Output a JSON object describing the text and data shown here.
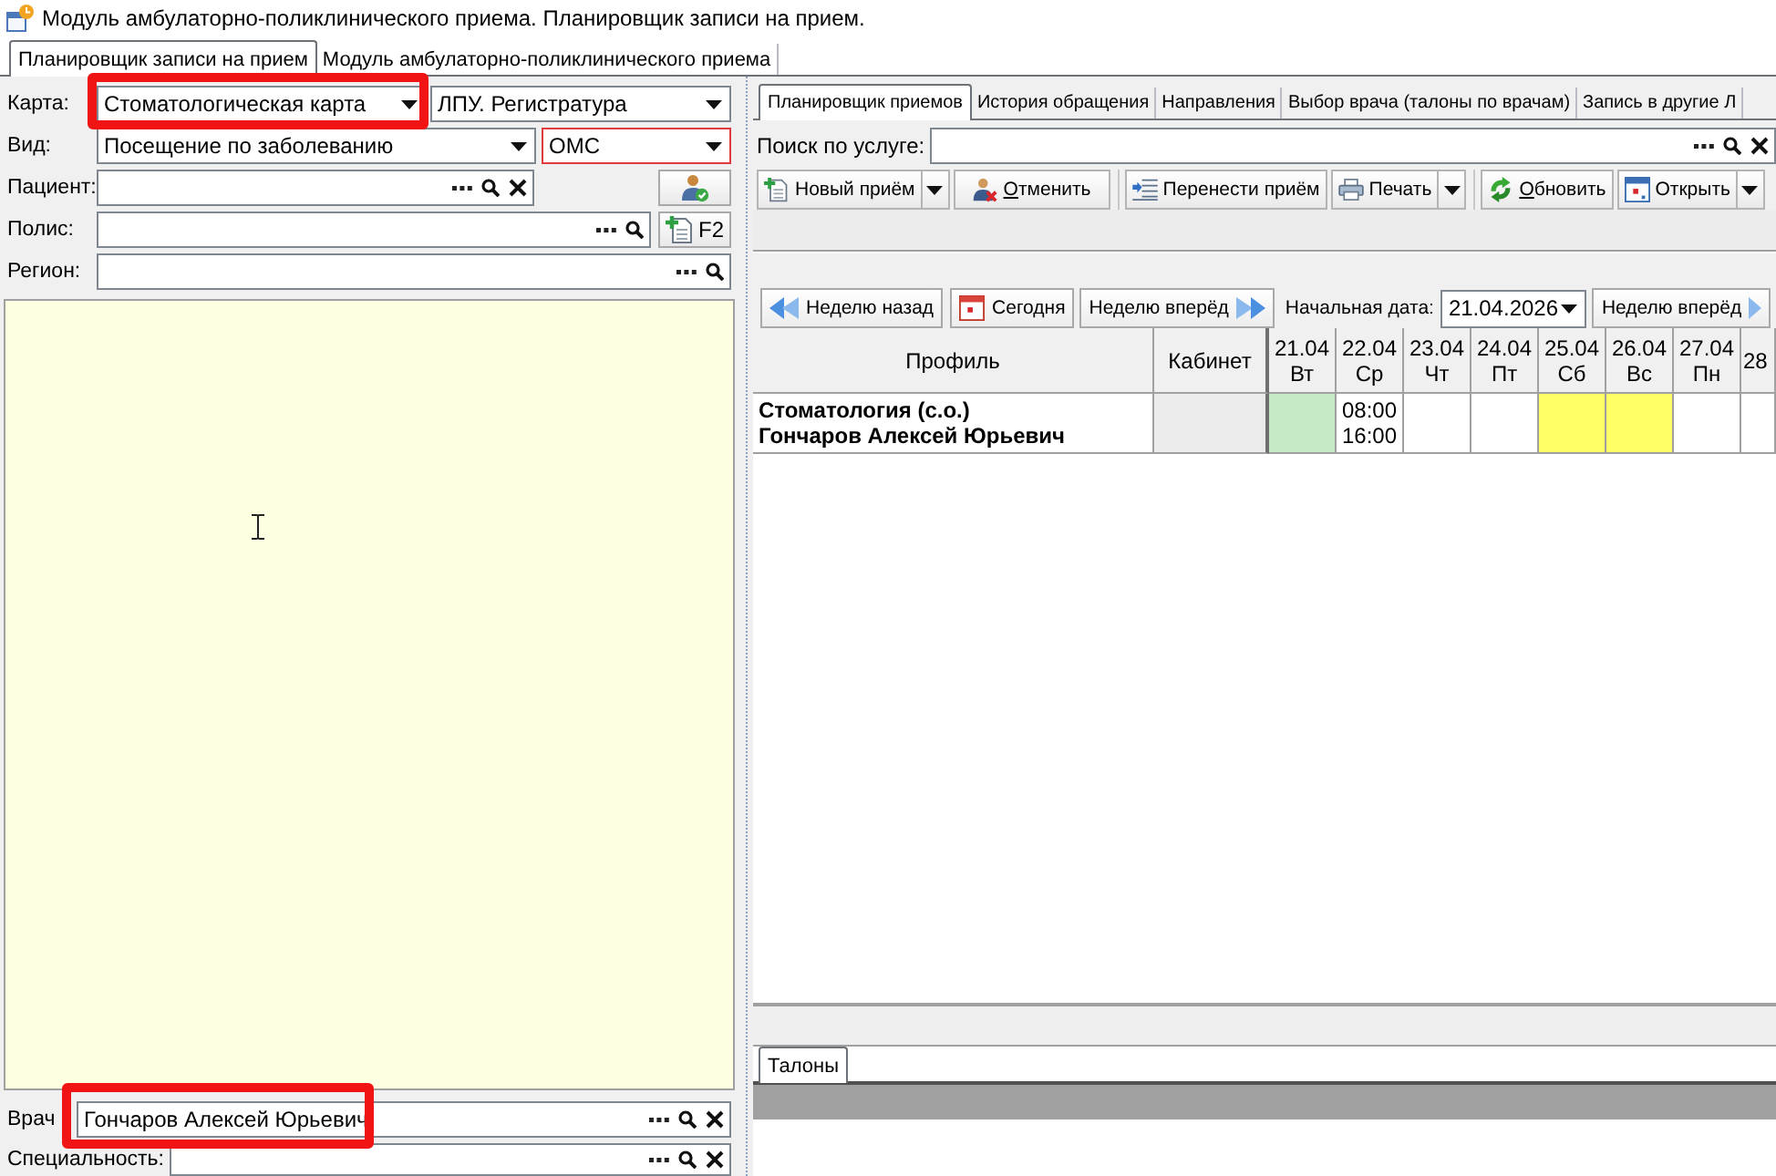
{
  "window": {
    "title": "Модуль амбулаторно-поликлинического приема. Планировщик записи на прием."
  },
  "module_tabs": [
    {
      "label": "Планировщик записи на прием",
      "selected": true
    },
    {
      "label": "Модуль амбулаторно-поликлинического приема",
      "selected": false
    }
  ],
  "left_form": {
    "card": {
      "label": "Карта:",
      "value": "Стоматологическая карта",
      "highlighted": true
    },
    "department": {
      "value": "ЛПУ. Регистратура",
      "error": false
    },
    "visit_type": {
      "label": "Вид:",
      "value": "Посещение по заболеванию"
    },
    "payment": {
      "value": "ОМС",
      "error": true
    },
    "patient": {
      "label": "Пациент:",
      "clearable": true
    },
    "policy": {
      "label": "Полис:",
      "clearable": false
    },
    "region": {
      "label": "Регион:",
      "clearable": false
    },
    "policy_button": {
      "label": "F2"
    }
  },
  "doctor": {
    "label": "Врач",
    "value": "Гончаров Алексей Юрьевич",
    "clearable": true,
    "highlighted": true
  },
  "specialty": {
    "label": "Специальность:",
    "clearable": true
  },
  "right_tabs": [
    {
      "label": "Планировщик приемов",
      "selected": true
    },
    {
      "label": "История обращения",
      "selected": false
    },
    {
      "label": "Направления",
      "selected": false
    },
    {
      "label": "Выбор врача (талоны по врачам)",
      "selected": false
    },
    {
      "label": "Запись в другие Л",
      "selected": false
    }
  ],
  "service_search": {
    "label": "Поиск по услуге:",
    "clearable": true
  },
  "toolbar": [
    {
      "buttons": [
        {
          "kind": "new",
          "label": "Новый приём",
          "dropdown": true,
          "mnemonic": false
        },
        {
          "kind": "cancel",
          "label": "Отменить",
          "dropdown": false,
          "mnemonic": true
        }
      ]
    },
    {
      "buttons": [
        {
          "kind": "move",
          "label": "Перенести приём",
          "dropdown": false,
          "mnemonic": false
        },
        {
          "kind": "print",
          "label": "Печать",
          "dropdown": true,
          "mnemonic": false
        }
      ]
    },
    {
      "buttons": [
        {
          "kind": "refresh",
          "label": "Обновить",
          "dropdown": false,
          "mnemonic": true
        },
        {
          "kind": "open",
          "label": "Открыть",
          "dropdown": true,
          "mnemonic": false
        }
      ]
    }
  ],
  "week_nav": {
    "back": {
      "label": "Неделю назад"
    },
    "today": {
      "label": "Сегодня"
    },
    "forward": {
      "label": "Неделю вперёд"
    },
    "start_date": {
      "label": "Начальная дата:",
      "value": "21.04.2026"
    },
    "forward_again": {
      "label": "Неделю вперёд"
    }
  },
  "schedule": {
    "columns": [
      "Профиль",
      "Кабинет"
    ],
    "days": [
      {
        "date": "21.04",
        "weekday": "Вт"
      },
      {
        "date": "22.04",
        "weekday": "Ср"
      },
      {
        "date": "23.04",
        "weekday": "Чт"
      },
      {
        "date": "24.04",
        "weekday": "Пт"
      },
      {
        "date": "25.04",
        "weekday": "Сб"
      },
      {
        "date": "26.04",
        "weekday": "Вс"
      },
      {
        "date": "27.04",
        "weekday": "Пн"
      },
      {
        "date": "28"
      }
    ],
    "rows": [
      {
        "profile": "Стоматология (с.о.)",
        "doctor": "Гончаров Алексей Юрьевич",
        "cells": [
          {
            "color": "#c6eac6"
          },
          {
            "color": "#ffffff",
            "times": [
              "08:00",
              "16:00"
            ]
          },
          {
            "color": "#ffffff"
          },
          {
            "color": "#ffffff"
          },
          {
            "color": "#ffff66"
          },
          {
            "color": "#ffff66"
          },
          {
            "color": "#ffffff"
          },
          {
            "color": "#ffffff"
          }
        ]
      }
    ]
  },
  "bottom_tabs": [
    {
      "label": "Талоны",
      "selected": true
    }
  ]
}
